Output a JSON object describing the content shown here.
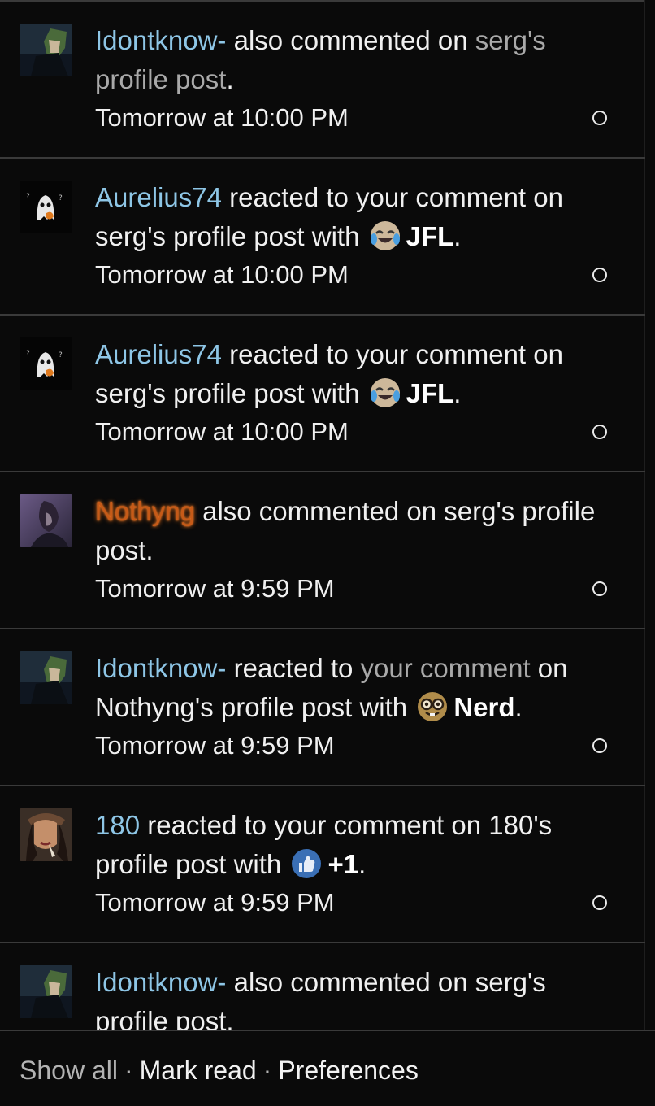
{
  "notifications": [
    {
      "user": "Idontknow-",
      "text_a": " also commented on ",
      "link": "serg's profile post",
      "text_b": ".",
      "time": "Tomorrow at 10:00 PM",
      "avatar": "dark-hooded-figure"
    },
    {
      "user": "Aurelius74",
      "text_a": " reacted to your comment on serg's profile post with ",
      "emoji": "laughing-crying-emoji",
      "reaction": "JFL",
      "text_b": ".",
      "time": "Tomorrow at 10:00 PM",
      "avatar": "ghost"
    },
    {
      "user": "Aurelius74",
      "text_a": " reacted to your comment on serg's profile post with ",
      "emoji": "laughing-crying-emoji",
      "reaction": "JFL",
      "text_b": ".",
      "time": "Tomorrow at 10:00 PM",
      "avatar": "ghost"
    },
    {
      "user": "Nothyng",
      "text_a": " also commented on serg's profile post.",
      "time": "Tomorrow at 9:59 PM",
      "avatar": "purple-portrait"
    },
    {
      "user": "Idontknow-",
      "text_a": " reacted to ",
      "link": "your comment",
      "text_b": " on Nothyng's profile post with ",
      "emoji": "nerd-emoji",
      "reaction": "Nerd",
      "text_c": ".",
      "time": "Tomorrow at 9:59 PM",
      "avatar": "dark-hooded-figure"
    },
    {
      "user": "180",
      "text_a": " reacted to your comment on 180's profile post with ",
      "emoji": "thumbs-up-emoji",
      "reaction": "+1",
      "text_b": ".",
      "time": "Tomorrow at 9:59 PM",
      "avatar": "woman-portrait"
    },
    {
      "user": "Idontknow-",
      "text_a": " also commented on serg's profile post.",
      "time": "",
      "avatar": "dark-hooded-figure"
    }
  ],
  "footer": {
    "show_all": "Show all",
    "mark_read": "Mark read",
    "preferences": "Preferences",
    "separator": "·"
  },
  "colors": {
    "background": "#0a0a0a",
    "username": "#8ec6e6",
    "username_glow": "#c65a18",
    "divider": "#3a3a3a"
  }
}
